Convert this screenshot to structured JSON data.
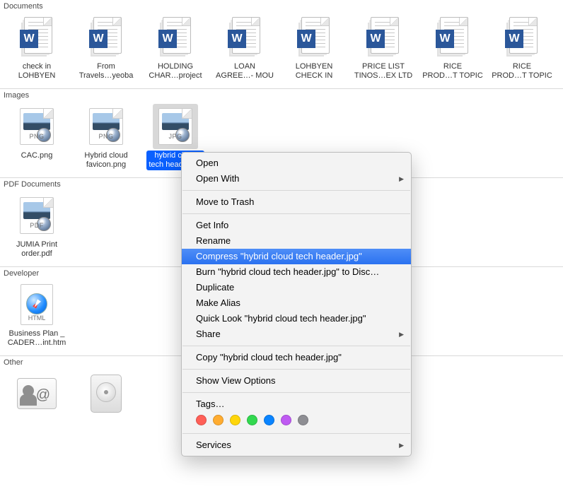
{
  "sections": {
    "documents": {
      "title": "Documents",
      "items": [
        {
          "l1": "check in",
          "l2": "LOHBYEN"
        },
        {
          "l1": "From",
          "l2": "Travels…yeoba"
        },
        {
          "l1": "HOLDING",
          "l2": "CHAR…project"
        },
        {
          "l1": "LOAN",
          "l2": "AGREE…- MOU"
        },
        {
          "l1": "LOHBYEN",
          "l2": "CHECK IN"
        },
        {
          "l1": "PRICE LIST",
          "l2": "TINOS…EX LTD"
        },
        {
          "l1": "RICE",
          "l2": "PROD…T TOPIC"
        },
        {
          "l1": "RICE",
          "l2": "PROD…T TOPIC"
        }
      ]
    },
    "images": {
      "title": "Images",
      "items": [
        {
          "fmt": "PNG",
          "l1": "CAC.png",
          "l2": "",
          "sel": false
        },
        {
          "fmt": "PNG",
          "l1": "Hybrid cloud",
          "l2": "favicon.png",
          "sel": false
        },
        {
          "fmt": "JPG",
          "l1": "hybrid cloud",
          "l2": "tech header.jpg",
          "sel": true
        }
      ]
    },
    "pdf": {
      "title": "PDF Documents",
      "items": [
        {
          "fmt": "PDF",
          "l1": "JUMIA Print",
          "l2": "order.pdf"
        }
      ]
    },
    "developer": {
      "title": "Developer",
      "items": [
        {
          "fmt": "HTML",
          "l1": "Business Plan _",
          "l2": "CADER…int.htm"
        }
      ]
    },
    "other": {
      "title": "Other"
    }
  },
  "menu": {
    "open": "Open",
    "open_with": "Open With",
    "trash": "Move to Trash",
    "get_info": "Get Info",
    "rename": "Rename",
    "compress": "Compress \"hybrid cloud tech header.jpg\"",
    "burn": "Burn \"hybrid cloud tech header.jpg\" to Disc…",
    "duplicate": "Duplicate",
    "make_alias": "Make Alias",
    "quick_look": "Quick Look \"hybrid cloud tech header.jpg\"",
    "share": "Share",
    "copy": "Copy \"hybrid cloud tech header.jpg\"",
    "view_options": "Show View Options",
    "tags": "Tags…",
    "services": "Services",
    "tag_colors": [
      "#ff5f57",
      "#ffac30",
      "#ffd60a",
      "#32d84f",
      "#0a84ff",
      "#bf5af2",
      "#8e8e93"
    ]
  }
}
